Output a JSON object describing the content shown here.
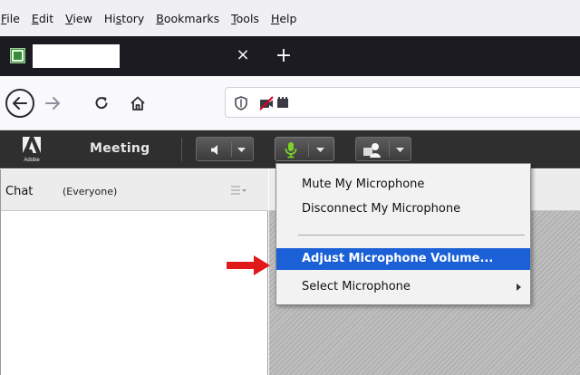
{
  "menubar": {
    "items": [
      {
        "underline": "F",
        "rest": "ile"
      },
      {
        "underline": "E",
        "rest": "dit"
      },
      {
        "underline": "V",
        "rest": "iew"
      },
      {
        "pre": "Hi",
        "underline": "s",
        "rest": "tory"
      },
      {
        "underline": "B",
        "rest": "ookmarks"
      },
      {
        "underline": "T",
        "rest": "ools"
      },
      {
        "underline": "H",
        "rest": "elp"
      }
    ]
  },
  "tab": {
    "close_glyph": "×",
    "new_tab_glyph": "+"
  },
  "appbar": {
    "logo_text": "Adobe",
    "meeting_label": "Meeting"
  },
  "chat": {
    "title": "Chat",
    "subtitle": "(Everyone)"
  },
  "mic_menu": {
    "items": [
      {
        "label": "Mute My Microphone"
      },
      {
        "label": "Disconnect My Microphone"
      },
      {
        "label": "Adjust Microphone Volume...",
        "selected": true
      },
      {
        "label": "Select Microphone",
        "submenu": true
      }
    ]
  },
  "colors": {
    "menu_highlight": "#1b60d6",
    "mic_active": "#7cd12a",
    "annotation_arrow": "#e0191a",
    "app_bar": "#2f2f2f"
  },
  "icons": [
    "back-arrow-icon",
    "forward-arrow-icon",
    "reload-icon",
    "home-icon",
    "shield-icon",
    "camera-blocked-icon",
    "speaker-icon",
    "microphone-icon",
    "webcam-icon",
    "hamburger-icon",
    "submenu-arrow-icon"
  ]
}
